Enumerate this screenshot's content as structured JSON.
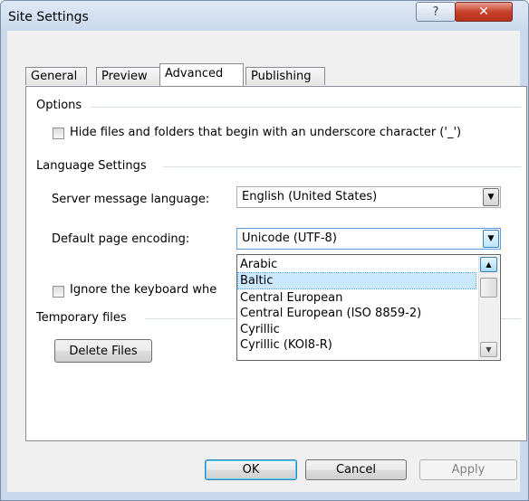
{
  "window": {
    "title": "Site Settings",
    "help_glyph": "?",
    "close_glyph": "✕",
    "icons": {
      "help": "help-icon",
      "close": "close-icon"
    }
  },
  "tabs": [
    {
      "label": "General",
      "active": false
    },
    {
      "label": "Preview",
      "active": false
    },
    {
      "label": "Advanced",
      "active": true
    },
    {
      "label": "Publishing",
      "active": false
    }
  ],
  "options": {
    "group_label": "Options",
    "hide_underscore": {
      "label": "Hide files and folders that begin with an underscore character ('_')",
      "checked": false
    }
  },
  "language": {
    "group_label": "Language Settings",
    "server_message": {
      "label": "Server message language:",
      "value": "English (United States)"
    },
    "page_encoding": {
      "label": "Default page encoding:",
      "value": "Unicode (UTF-8)"
    },
    "ignore_keyboard": {
      "label": "Ignore the keyboard whe",
      "checked": false
    }
  },
  "encoding_dropdown": {
    "items": [
      "Arabic",
      "Baltic",
      "Central European",
      "Central European (ISO 8859-2)",
      "Cyrillic",
      "Cyrillic (KOI8-R)"
    ],
    "highlighted": "Baltic"
  },
  "temporary": {
    "group_label": "Temporary files",
    "delete_label": "Delete Files"
  },
  "footer": {
    "ok": "OK",
    "cancel": "Cancel",
    "apply": "Apply"
  },
  "glyphs": {
    "down_arrow": "▼",
    "up_arrow": "▲"
  },
  "colors": {
    "selection": "#cce8ff",
    "title_bar": "#c9d8ec",
    "close": "#c7412b"
  }
}
